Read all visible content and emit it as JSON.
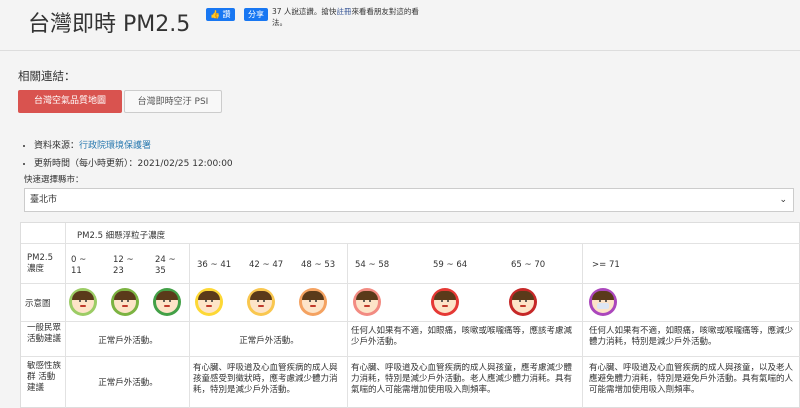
{
  "header": {
    "title": "台灣即時 PM2.5",
    "fb_like": "讚",
    "fb_share": "分享",
    "fb_text_prefix": "37 人說這讚。搶快",
    "fb_text_link": "註冊",
    "fb_text_suffix": "來看看朋友對這的看法。"
  },
  "related": {
    "label": "相關連結：",
    "buttons": [
      {
        "label": "台灣空氣品質地圖"
      },
      {
        "label": "台灣即時空汙 PSI"
      }
    ]
  },
  "info": {
    "source_prefix": "資料來源：",
    "source_link": "行政院環境保護署",
    "updated": "更新時間（每小時更新）：2021/02/25 12:00:00"
  },
  "city": {
    "label": "快速選擇縣市：",
    "selected": "臺北市"
  },
  "table": {
    "section_header": "PM2.5 細懸浮粒子濃度",
    "row_labels": {
      "pm25": "PM2.5 濃度",
      "icon": "示意圖",
      "general": "一般民眾活動建議",
      "sensitive": "敏感性族群 活動建議"
    },
    "ranges": [
      "0 ~ 11",
      "12 ~ 23",
      "24 ~ 35",
      "36 ~ 41",
      "42 ~ 47",
      "48 ~ 53",
      "54 ~ 58",
      "59 ~ 64",
      "65 ~ 70",
      ">= 71"
    ],
    "face_colors": [
      "#9ccc65",
      "#7cb342",
      "#43a047",
      "#fdd835",
      "#f9c74f",
      "#f4a261",
      "#f28b82",
      "#e53935",
      "#c62828",
      "#ab47bc"
    ],
    "general_advice": [
      "正常戶外活動。",
      "正常戶外活動。",
      "任何人如果有不適，如眼痛，咳嗽或喉嚨痛等，應該考慮減少戶外活動。",
      "任何人如果有不適，如眼痛，咳嗽或喉嚨痛等，應減少體力消耗，特別是減少戶外活動。"
    ],
    "sensitive_advice": [
      "正常戶外活動。",
      "有心臟、呼吸道及心血管疾病的成人與孩童感受到徵狀時，應考慮減少體力消耗，特別是減少戶外活動。",
      "有心臟、呼吸道及心血管疾病的成人與孩童，應考慮減少體力消耗，特別是減少戶外活動。老人應減少體力消耗。具有氣喘的人可能需增加使用吸入劑頻率。",
      "有心臟、呼吸道及心血管疾病的成人與孩童，以及老人應避免體力消耗，特別是避免戶外活動。具有氣喘的人可能需增加使用吸入劑頻率。"
    ]
  }
}
